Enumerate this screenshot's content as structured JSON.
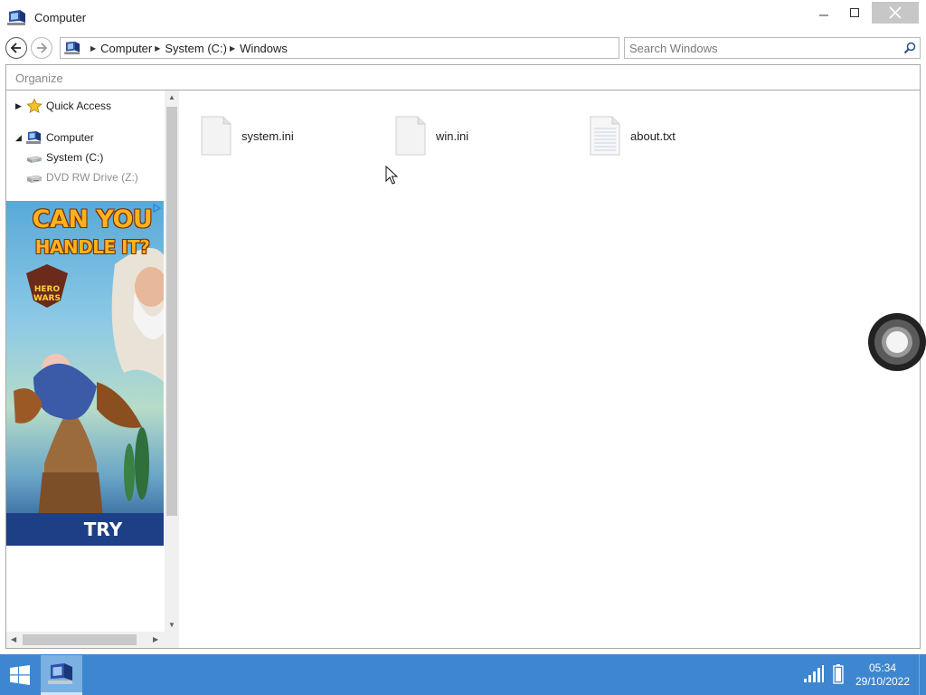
{
  "window": {
    "title": "Computer",
    "controls": {
      "minimize": "minimize-icon",
      "maximize": "maximize-icon",
      "close": "close-icon"
    }
  },
  "navigation": {
    "back_icon": "arrow-left-icon",
    "forward_icon": "arrow-right-icon",
    "breadcrumbs": [
      "Computer",
      "System (C:)",
      "Windows"
    ],
    "search": {
      "placeholder": "Search Windows",
      "value": ""
    }
  },
  "toolbar": {
    "organize_label": "Organize"
  },
  "sidebar": {
    "items": [
      {
        "label": "Quick Access",
        "icon": "star-icon",
        "expander": "collapsed",
        "indent": 0
      },
      {
        "label": "Computer",
        "icon": "computer-icon",
        "expander": "expanded",
        "indent": 0
      },
      {
        "label": "System (C:)",
        "icon": "drive-icon",
        "expander": "none",
        "indent": 1
      },
      {
        "label": "DVD RW Drive (Z:)",
        "icon": "dvd-drive-icon",
        "expander": "none",
        "indent": 1,
        "disabled": true
      }
    ]
  },
  "ad": {
    "headline_line1": "CAN YOU",
    "headline_line2": "HANDLE IT?",
    "cta": "TRY"
  },
  "files": [
    {
      "name": "system.ini",
      "icon": "ini-file-icon"
    },
    {
      "name": "win.ini",
      "icon": "ini-file-icon"
    },
    {
      "name": "about.txt",
      "icon": "text-file-icon"
    }
  ],
  "taskbar": {
    "start_icon": "windows-logo-icon",
    "pinned": [
      {
        "name": "File Explorer",
        "icon": "computer-icon",
        "active": true
      }
    ],
    "tray": {
      "signal_icon": "signal-icon",
      "battery_icon": "battery-icon"
    },
    "clock": {
      "time": "05:34",
      "date": "29/10/2022"
    }
  },
  "colors": {
    "taskbar": "#3e86cf",
    "taskbar_active": "#7ab0e2",
    "close_button": "#c7c7c7",
    "border": "#a9a9a9"
  }
}
